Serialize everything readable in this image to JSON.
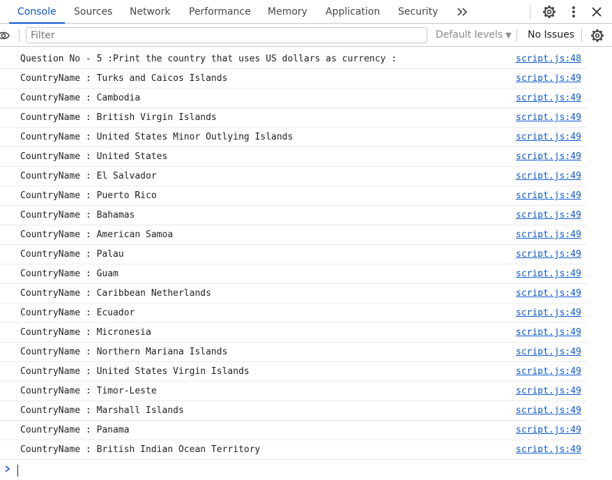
{
  "tabs": [
    {
      "label": "Console",
      "active": true
    },
    {
      "label": "Sources",
      "active": false
    },
    {
      "label": "Network",
      "active": false
    },
    {
      "label": "Performance",
      "active": false
    },
    {
      "label": "Memory",
      "active": false
    },
    {
      "label": "Application",
      "active": false
    },
    {
      "label": "Security",
      "active": false
    }
  ],
  "toolbar": {
    "filter_placeholder": "Filter",
    "levels_label": "Default levels",
    "issues_label": "No Issues"
  },
  "colors": {
    "accent": "#0b57d0",
    "text": "#1f1f1f",
    "muted": "#8a8a8a",
    "border": "#c7c7c7"
  },
  "icons": [
    "more-tabs-icon",
    "settings-gear-icon",
    "kebab-menu-icon",
    "close-icon",
    "eye-icon",
    "dropdown-caret-icon",
    "console-prompt-icon"
  ],
  "messages": [
    {
      "text": "Question No - 5 :Print the country that uses US dollars as currency :",
      "source": "script.js:48"
    },
    {
      "text": "CountryName : Turks and Caicos Islands",
      "source": "script.js:49"
    },
    {
      "text": "CountryName : Cambodia",
      "source": "script.js:49"
    },
    {
      "text": "CountryName : British Virgin Islands",
      "source": "script.js:49"
    },
    {
      "text": "CountryName : United States Minor Outlying Islands",
      "source": "script.js:49"
    },
    {
      "text": "CountryName : United States",
      "source": "script.js:49"
    },
    {
      "text": "CountryName : El Salvador",
      "source": "script.js:49"
    },
    {
      "text": "CountryName : Puerto Rico",
      "source": "script.js:49"
    },
    {
      "text": "CountryName : Bahamas",
      "source": "script.js:49"
    },
    {
      "text": "CountryName : American Samoa",
      "source": "script.js:49"
    },
    {
      "text": "CountryName : Palau",
      "source": "script.js:49"
    },
    {
      "text": "CountryName : Guam",
      "source": "script.js:49"
    },
    {
      "text": "CountryName : Caribbean Netherlands",
      "source": "script.js:49"
    },
    {
      "text": "CountryName : Ecuador",
      "source": "script.js:49"
    },
    {
      "text": "CountryName : Micronesia",
      "source": "script.js:49"
    },
    {
      "text": "CountryName : Northern Mariana Islands",
      "source": "script.js:49"
    },
    {
      "text": "CountryName : United States Virgin Islands",
      "source": "script.js:49"
    },
    {
      "text": "CountryName : Timor-Leste",
      "source": "script.js:49"
    },
    {
      "text": "CountryName : Marshall Islands",
      "source": "script.js:49"
    },
    {
      "text": "CountryName : Panama",
      "source": "script.js:49"
    },
    {
      "text": "CountryName : British Indian Ocean Territory",
      "source": "script.js:49"
    }
  ]
}
